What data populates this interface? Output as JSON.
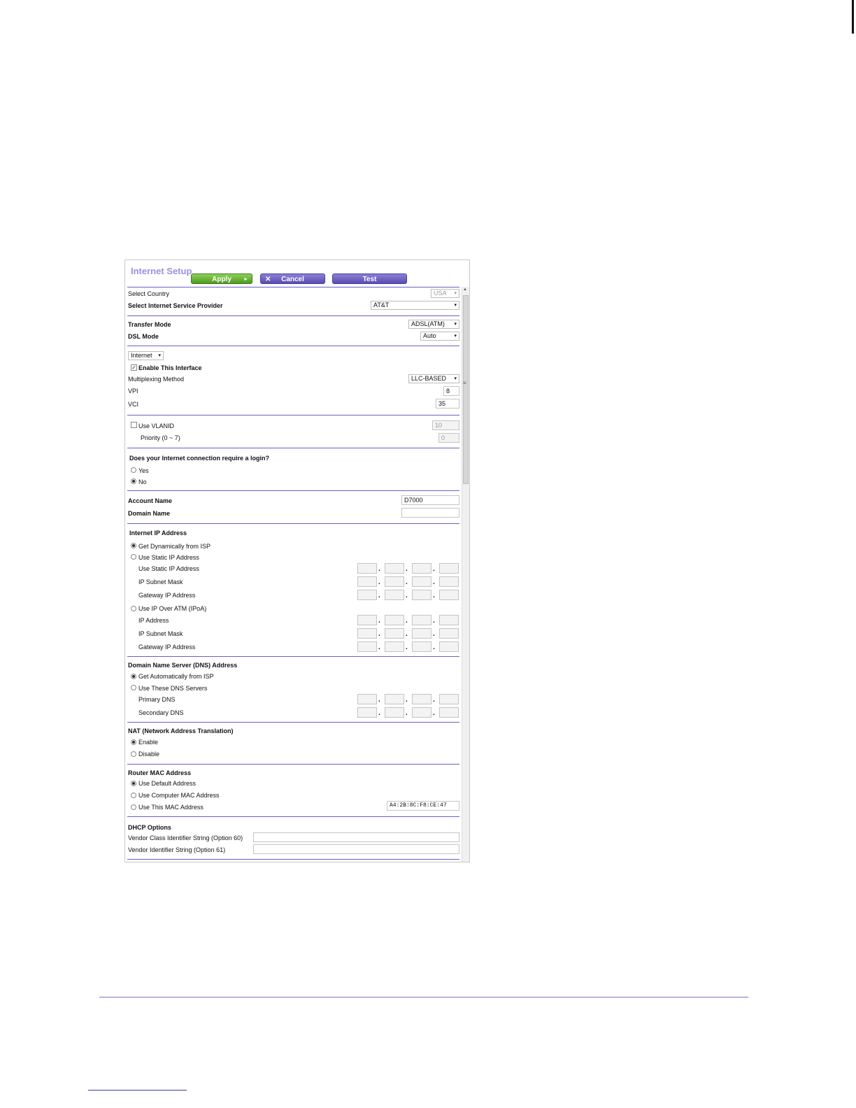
{
  "header": {
    "title": "Internet Setup",
    "apply": "Apply",
    "cancel": "Cancel",
    "test": "Test"
  },
  "general": {
    "country_label": "Select Country",
    "country_value": "USA",
    "isp_label": "Select Internet Service Provider",
    "isp_value": "AT&T"
  },
  "dsl": {
    "transfer_label": "Transfer Mode",
    "transfer_value": "ADSL(ATM)",
    "dsl_label": "DSL Mode",
    "dsl_value": "Auto"
  },
  "iface": {
    "type_value": "Internet",
    "enable_label": "Enable This Interface",
    "mux_label": "Multiplexing Method",
    "mux_value": "LLC-BASED",
    "vpi_label": "VPI",
    "vpi_value": "8",
    "vci_label": "VCI",
    "vci_value": "35"
  },
  "vlan": {
    "use_label": "Use VLANID",
    "use_value": "10",
    "priority_label": "Priority (0 ~ 7)",
    "priority_value": "0"
  },
  "login": {
    "question": "Does your Internet connection require a login?",
    "yes": "Yes",
    "no": "No"
  },
  "account": {
    "name_label": "Account Name",
    "name_value": "D7000",
    "domain_label": "Domain Name",
    "domain_value": ""
  },
  "ip": {
    "heading": "Internet IP Address",
    "dynamic": "Get Dynamically from ISP",
    "static": "Use Static IP Address",
    "static_ip": "Use Static IP Address",
    "subnet": "IP Subnet Mask",
    "gateway": "Gateway IP Address",
    "ipoa": "Use IP Over ATM (IPoA)",
    "ipoa_ip": "IP Address",
    "ipoa_subnet": "IP Subnet Mask",
    "ipoa_gateway": "Gateway IP Address"
  },
  "dns": {
    "heading": "Domain Name Server (DNS) Address",
    "auto": "Get Automatically from ISP",
    "manual": "Use These DNS Servers",
    "primary": "Primary DNS",
    "secondary": "Secondary DNS"
  },
  "nat": {
    "heading": "NAT (Network Address Translation)",
    "enable": "Enable",
    "disable": "Disable"
  },
  "mac": {
    "heading": "Router MAC Address",
    "default": "Use Default Address",
    "computer": "Use Computer MAC Address",
    "this": "Use This MAC Address",
    "value": "A4:2B:8C:F8:CE:47"
  },
  "dhcp": {
    "heading": "DHCP Options",
    "opt60": "Vendor Class Identifier String (Option 60)",
    "opt61": "Vendor Identifier String (Option 61)"
  }
}
